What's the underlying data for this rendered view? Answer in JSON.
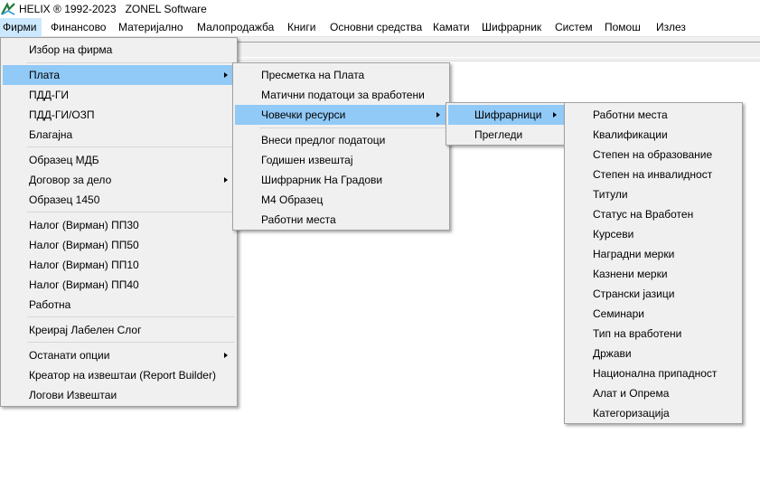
{
  "titlebar": {
    "title": "HELIX ® 1992-2023   ZONEL Software"
  },
  "menubar": {
    "items": [
      "Фирми",
      "Финансово",
      "Материјално",
      "Малопродажба",
      "Книги",
      "Основни средства",
      "Камати",
      "Шифрарник",
      "Систем",
      "Помош",
      "Излез"
    ]
  },
  "firmi_menu": {
    "items": [
      "Избор на фирма",
      "Плата",
      "ПДД-ГИ",
      "ПДД-ГИ/ОЗП",
      "Благајна",
      "Образец МДБ",
      "Договор за дело",
      "Образец 1450",
      "Налог (Вирман) ПП30",
      "Налог (Вирман) ПП50",
      "Налог (Вирман) ПП10",
      "Налог (Вирман) ПП40",
      "Работна",
      "Креирај Лабелен Слог",
      "Останати опции",
      "Креатор на извештаи (Report Builder)",
      "Логови Извештаи"
    ]
  },
  "plata_menu": {
    "items": [
      "Пресметка на Плата",
      "Матични податоци за вработени",
      "Човечки ресурси",
      "Внеси предлог податоци",
      "Годишен извештај",
      "Шифрарник На Градови",
      "М4 Образец",
      "Работни места"
    ]
  },
  "hr_menu": {
    "items": [
      "Шифрарници",
      "Прегледи"
    ]
  },
  "codes_menu": {
    "items": [
      "Работни места",
      "Квалификации",
      "Степен на образование",
      "Степен на инвалидност",
      "Титули",
      "Статус на Вработен",
      "Курсеви",
      "Наградни мерки",
      "Казнени мерки",
      "Странски јазици",
      "Семинари",
      "Тип на вработени",
      "Држави",
      "Национална припадност",
      "Алат и Опрема",
      "Категоризација"
    ]
  },
  "colors": {
    "menu_highlight": "#cce8ff",
    "item_selected": "#91c9f7",
    "menu_bg": "#f0f0f0"
  }
}
